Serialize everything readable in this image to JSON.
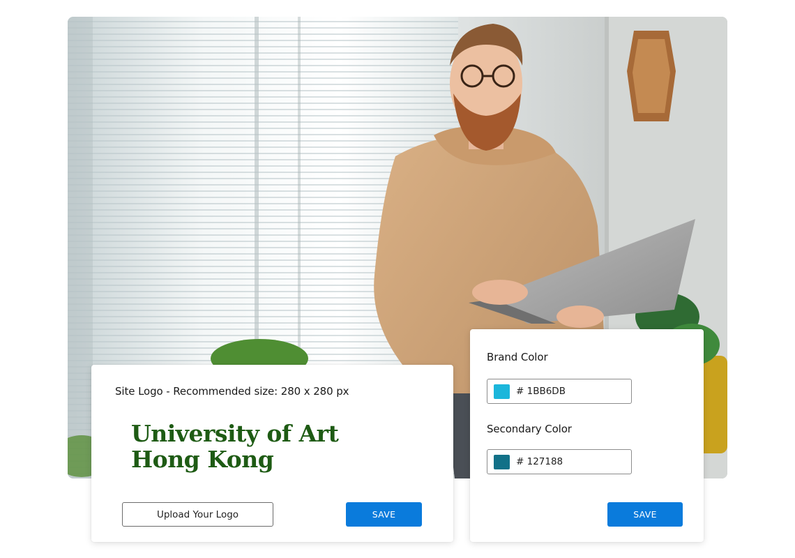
{
  "hero": {
    "image": "man-in-hoodie-with-laptop-by-window-blinds"
  },
  "logo_card": {
    "label": "Site Logo - Recommended size: 280 x 280 px",
    "logo_line1": "University of Art",
    "logo_line2": "Hong Kong",
    "logo_color": "#1e5b14",
    "upload_label": "Upload Your Logo",
    "save_label": "SAVE"
  },
  "color_card": {
    "brand_label": "Brand Color",
    "brand_value": "# 1BB6DB",
    "brand_swatch": "#1BB6DB",
    "secondary_label": "Secondary Color",
    "secondary_value": "# 127188",
    "secondary_swatch": "#127188",
    "save_label": "SAVE"
  },
  "colors": {
    "accent": "#0a7bdc"
  }
}
